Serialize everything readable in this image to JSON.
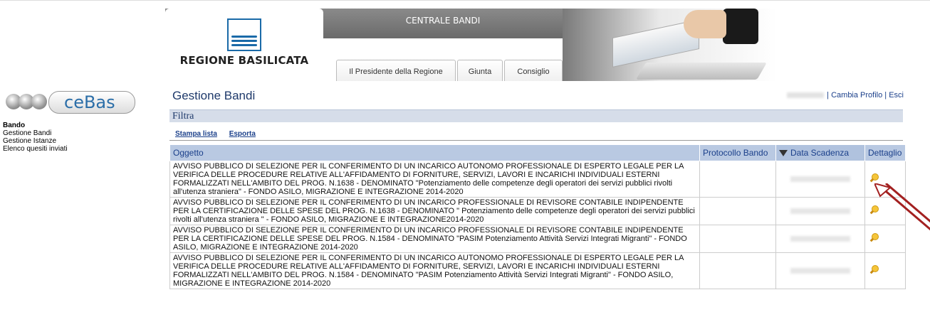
{
  "header": {
    "region_name": "REGIONE BASILICATA",
    "central_title": "CENTRALE BANDI",
    "tabs": [
      "Il Presidente della Regione",
      "Giunta",
      "Consiglio"
    ]
  },
  "sidebar": {
    "logo_text": "ceBas",
    "items": [
      {
        "label": "Bando",
        "bold": true
      },
      {
        "label": "Gestione Bandi",
        "bold": false
      },
      {
        "label": "Gestione Istanze",
        "bold": false
      },
      {
        "label": "Elenco quesiti inviati",
        "bold": false
      }
    ]
  },
  "main": {
    "title": "Gestione Bandi",
    "user_links": {
      "cambia_profilo": "Cambia Profilo",
      "esci": "Esci",
      "sep": "|"
    },
    "filter_label": "Filtra",
    "actions": {
      "print": "Stampa lista",
      "export": "Esporta"
    },
    "table": {
      "columns": [
        "Oggetto",
        "Protocollo Bando",
        "Data Scadenza",
        "Dettaglio"
      ],
      "rows": [
        {
          "oggetto": "AVVISO PUBBLICO DI SELEZIONE PER IL CONFERIMENTO DI UN INCARICO AUTONOMO PROFESSIONALE DI ESPERTO LEGALE PER LA VERIFICA DELLE PROCEDURE RELATIVE ALL'AFFIDAMENTO DI FORNITURE, SERVIZI, LAVORI E INCARICHI INDIVIDUALI ESTERNI FORMALIZZATI NELL'AMBITO DEL PROG. N.1638 - DENOMINATO \"Potenziamento delle competenze degli operatori dei servizi pubblici rivolti all'utenza straniera\" - FONDO ASILO, MIGRAZIONE E INTEGRAZIONE 2014-2020",
          "protocollo": ""
        },
        {
          "oggetto": "AVVISO PUBBLICO DI SELEZIONE PER IL CONFERIMENTO DI UN INCARICO PROFESSIONALE DI REVISORE CONTABILE INDIPENDENTE PER LA CERTIFICAZIONE DELLE SPESE DEL PROG. N.1638 - DENOMINATO \" Potenziamento delle competenze degli operatori dei servizi pubblici rivolti all'utenza straniera \" - FONDO ASILO, MIGRAZIONE E INTEGRAZIONE2014-2020",
          "protocollo": ""
        },
        {
          "oggetto": "AVVISO PUBBLICO DI SELEZIONE PER IL CONFERIMENTO DI UN INCARICO PROFESSIONALE DI REVISORE CONTABILE INDIPENDENTE PER LA CERTIFICAZIONE DELLE SPESE DEL PROG. N.1584 - DENOMINATO \"PASIM Potenziamento Attività Servizi Integrati Migranti\" - FONDO ASILO, MIGRAZIONE E INTEGRAZIONE 2014-2020",
          "protocollo": ""
        },
        {
          "oggetto": "AVVISO PUBBLICO DI SELEZIONE PER IL CONFERIMENTO DI UN INCARICO AUTONOMO PROFESSIONALE DI ESPERTO LEGALE PER LA VERIFICA DELLE PROCEDURE RELATIVE ALL'AFFIDAMENTO DI FORNITURE, SERVIZI, LAVORI E INCARICHI INDIVIDUALI ESTERNI FORMALIZZATI NELL'AMBITO DEL PROG. N.1584 - DENOMINATO \"PASIM Potenziamento Attività Servizi Integrati Migranti\" - FONDO ASILO, MIGRAZIONE E INTEGRAZIONE 2014-2020",
          "protocollo": ""
        }
      ]
    }
  },
  "colors": {
    "accent": "#1f3a6b",
    "header_row": "#b9c9e2",
    "arrow": "#a32020"
  },
  "icons": [
    "sort-down-icon",
    "magnifier-icon",
    "arrow-pointer-icon",
    "region-crest-icon"
  ]
}
